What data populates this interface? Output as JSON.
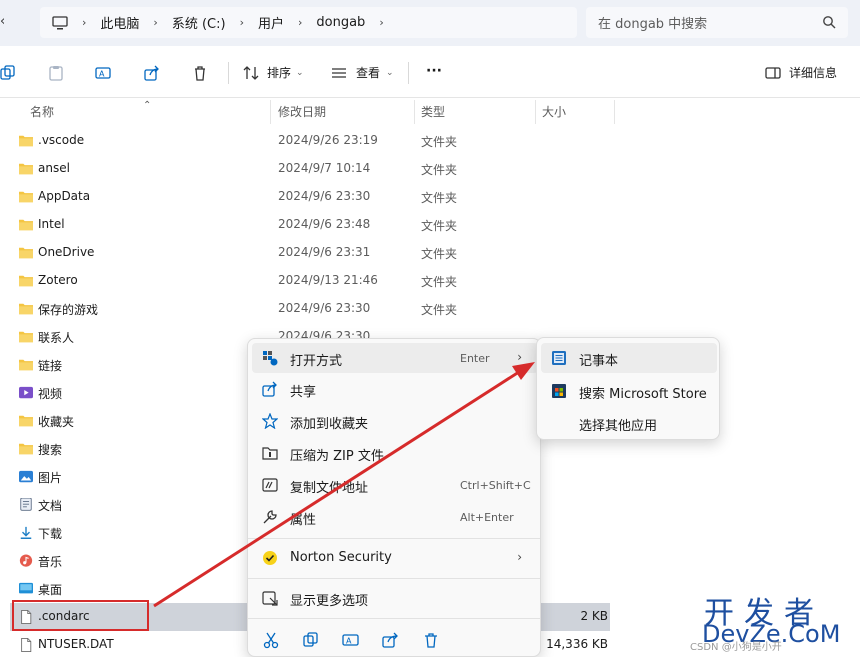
{
  "address": {
    "segments": [
      "此电脑",
      "系统 (C:)",
      "用户",
      "dongab"
    ],
    "search_placeholder": "在 dongab 中搜索"
  },
  "toolbar": {
    "sort_label": "排序",
    "view_label": "查看",
    "more_label": "···",
    "details_label": "详细信息"
  },
  "columns": {
    "name": "名称",
    "date": "修改日期",
    "type": "类型",
    "size": "大小"
  },
  "files": [
    {
      "name": ".vscode",
      "date": "2024/9/26 23:19",
      "type": "文件夹",
      "size": "",
      "icon": "folder-icon"
    },
    {
      "name": "ansel",
      "date": "2024/9/7 10:14",
      "type": "文件夹",
      "size": "",
      "icon": "folder-icon"
    },
    {
      "name": "AppData",
      "date": "2024/9/6 23:30",
      "type": "文件夹",
      "size": "",
      "icon": "folder-icon"
    },
    {
      "name": "Intel",
      "date": "2024/9/6 23:48",
      "type": "文件夹",
      "size": "",
      "icon": "folder-icon"
    },
    {
      "name": "OneDrive",
      "date": "2024/9/6 23:31",
      "type": "文件夹",
      "size": "",
      "icon": "folder-icon"
    },
    {
      "name": "Zotero",
      "date": "2024/9/13 21:46",
      "type": "文件夹",
      "size": "",
      "icon": "folder-icon"
    },
    {
      "name": "保存的游戏",
      "date": "2024/9/6 23:30",
      "type": "文件夹",
      "size": "",
      "icon": "folder-icon"
    },
    {
      "name": "联系人",
      "date": "2024/9/6 23:30",
      "type": "",
      "size": "",
      "icon": "folder-icon"
    },
    {
      "name": "链接",
      "date": "",
      "type": "",
      "size": "",
      "icon": "folder-icon"
    },
    {
      "name": "视频",
      "date": "",
      "type": "",
      "size": "",
      "icon": "video-folder-icon"
    },
    {
      "name": "收藏夹",
      "date": "",
      "type": "",
      "size": "",
      "icon": "folder-icon"
    },
    {
      "name": "搜索",
      "date": "",
      "type": "",
      "size": "",
      "icon": "folder-icon"
    },
    {
      "name": "图片",
      "date": "",
      "type": "",
      "size": "",
      "icon": "pictures-folder-icon"
    },
    {
      "name": "文档",
      "date": "",
      "type": "",
      "size": "",
      "icon": "documents-folder-icon"
    },
    {
      "name": "下载",
      "date": "",
      "type": "",
      "size": "",
      "icon": "download-icon"
    },
    {
      "name": "音乐",
      "date": "",
      "type": "",
      "size": "",
      "icon": "music-folder-icon"
    },
    {
      "name": "桌面",
      "date": "",
      "type": "",
      "size": "",
      "icon": "desktop-folder-icon"
    },
    {
      "name": ".condarc",
      "date": "",
      "type": "",
      "size": "2 KB",
      "icon": "file-icon"
    },
    {
      "name": "NTUSER.DAT",
      "date": "",
      "type": "",
      "size": "14,336 KB",
      "icon": "file-icon"
    }
  ],
  "context_menu": {
    "items": [
      {
        "label": "打开方式",
        "key": "Enter",
        "submenu": true,
        "icon": "open-with-icon"
      },
      {
        "label": "共享",
        "key": "",
        "submenu": false,
        "icon": "share-icon"
      },
      {
        "label": "添加到收藏夹",
        "key": "",
        "submenu": false,
        "icon": "star-icon"
      },
      {
        "label": "压缩为 ZIP 文件",
        "key": "",
        "submenu": false,
        "icon": "zip-icon"
      },
      {
        "label": "复制文件地址",
        "key": "Ctrl+Shift+C",
        "submenu": false,
        "icon": "copy-path-icon"
      },
      {
        "label": "属性",
        "key": "Alt+Enter",
        "submenu": false,
        "icon": "wrench-icon"
      },
      {
        "label": "Norton Security",
        "key": "",
        "submenu": true,
        "icon": "norton-icon"
      },
      {
        "label": "显示更多选项",
        "key": "",
        "submenu": false,
        "icon": "more-options-icon"
      }
    ]
  },
  "submenu": {
    "items": [
      {
        "label": "记事本",
        "icon": "notepad-icon"
      },
      {
        "label": "搜索 Microsoft Store",
        "icon": "store-icon"
      },
      {
        "label": "选择其他应用",
        "icon": ""
      }
    ]
  },
  "watermark": {
    "line1": "开发者",
    "line2": "DevZe.CoM",
    "csdn": "CSDN @小狗是小开"
  },
  "colors": {
    "folder": "#f4c542",
    "accent": "#0067c0",
    "arrow": "#d62b2b",
    "selection": "#cfd3da"
  }
}
